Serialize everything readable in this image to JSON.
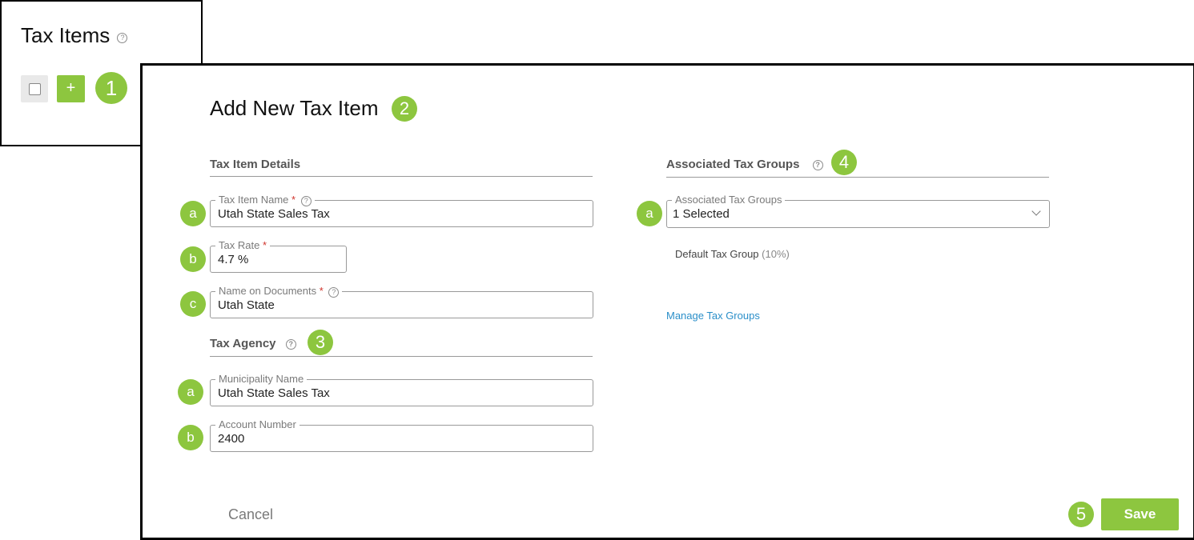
{
  "list_panel": {
    "title": "Tax Items",
    "help_icon": "help-icon",
    "add_label": "+",
    "callout": "1"
  },
  "dialog": {
    "title": "Add New Tax Item",
    "title_callout": "2",
    "details": {
      "heading": "Tax Item Details",
      "fields": [
        {
          "marker": "a",
          "label": "Tax Item Name",
          "required": "*",
          "value": "Utah State Sales Tax"
        },
        {
          "marker": "b",
          "label": "Tax Rate",
          "required": "*",
          "value": "4.7 %"
        },
        {
          "marker": "c",
          "label": "Name on Documents",
          "required": "*",
          "value": "Utah State"
        }
      ]
    },
    "agency": {
      "heading": "Tax Agency",
      "callout": "3",
      "fields": [
        {
          "marker": "a",
          "label": "Municipality Name",
          "value": "Utah State Sales Tax"
        },
        {
          "marker": "b",
          "label": "Account Number",
          "value": "2400"
        }
      ]
    },
    "groups": {
      "heading": "Associated Tax Groups",
      "callout": "4",
      "field": {
        "marker": "a",
        "label": "Associated Tax Groups",
        "value": "1 Selected"
      },
      "selected_name": "Default Tax Group",
      "selected_rate": "(10%)",
      "manage_link": "Manage Tax Groups"
    },
    "footer": {
      "cancel_label": "Cancel",
      "save_label": "Save",
      "save_callout": "5"
    }
  },
  "colors": {
    "accent": "#8dc63f",
    "link": "#2b8fc9",
    "required": "#d0342c"
  }
}
